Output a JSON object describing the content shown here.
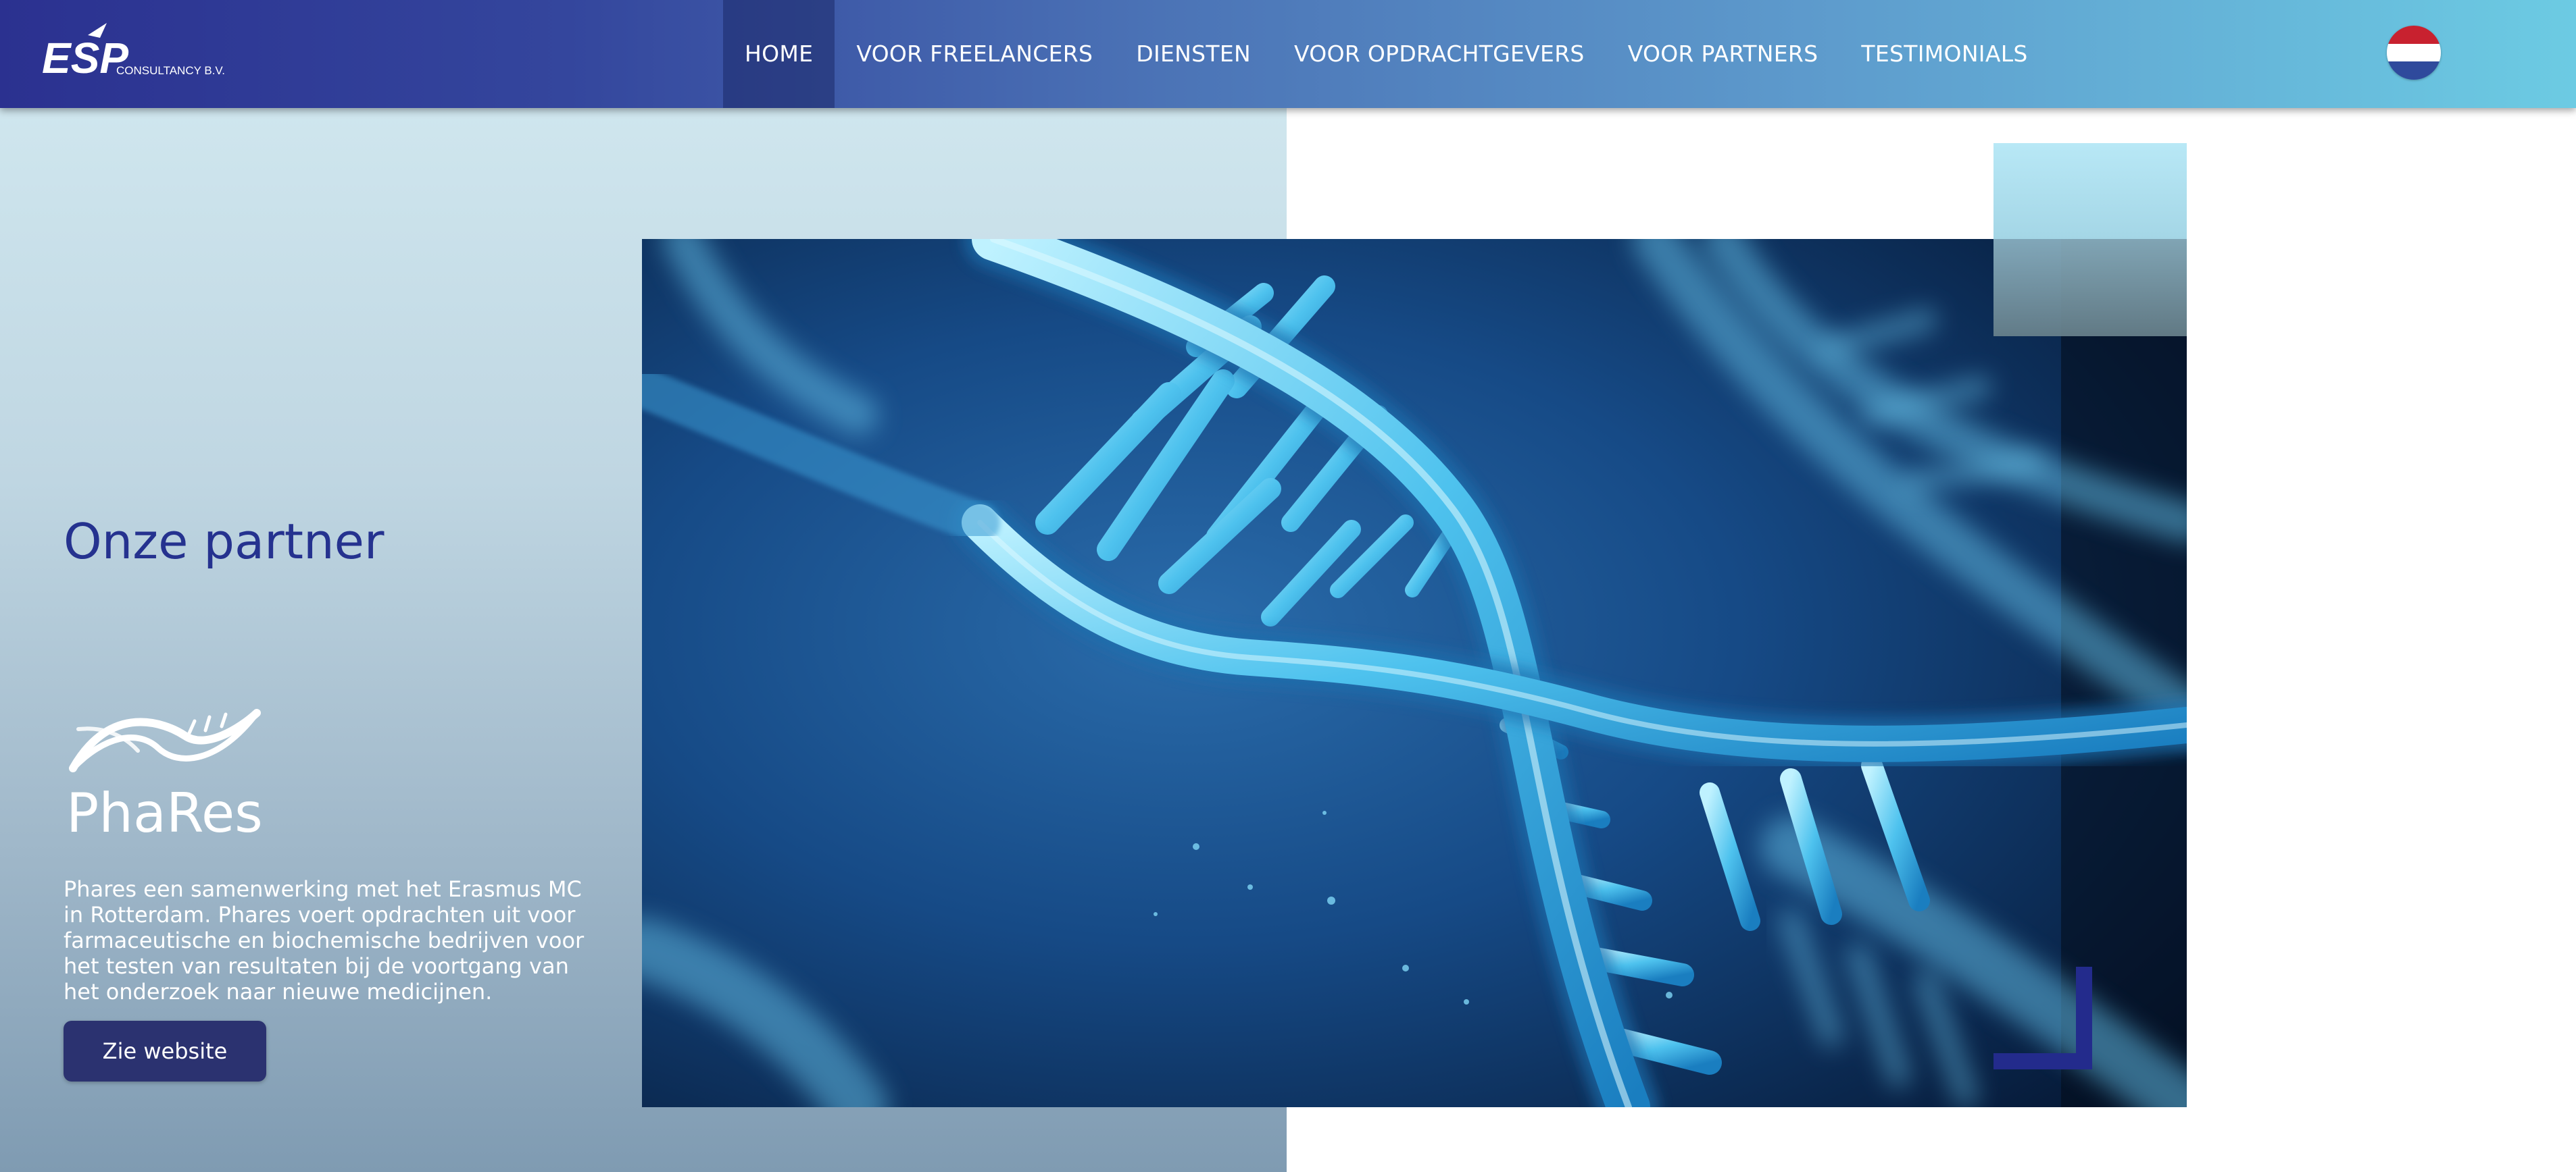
{
  "brand": {
    "logo_letters": "ESP",
    "logo_subtitle": "CONSULTANCY B.V."
  },
  "nav": {
    "items": [
      {
        "label": "HOME",
        "active": true
      },
      {
        "label": "VOOR FREELANCERS"
      },
      {
        "label": "DIENSTEN"
      },
      {
        "label": "VOOR OPDRACHTGEVERS"
      },
      {
        "label": "VOOR PARTNERS"
      },
      {
        "label": "TESTIMONIALS"
      }
    ]
  },
  "language": {
    "flag": "dutch-flag-icon",
    "colors": [
      "#c8212f",
      "#ffffff",
      "#2f4a9c"
    ]
  },
  "partner": {
    "section_title": "Onze partner",
    "logo_text": "PhaRes",
    "description": "Phares een samenwerking met het Erasmus MC in Rotterdam. Phares voert opdrachten uit voor farmaceutische en biochemische bedrijven voor het testen van resultaten bij de voortgang van het onderzoek naar nieuwe medicijnen.",
    "button_label": "Zie website"
  },
  "hero": {
    "image": "dna-helix-image"
  },
  "colors": {
    "title_blue": "#25328f",
    "button_dark": "#2b3270",
    "accent_navy": "#232b8c",
    "nav_gradient_start": "#2b3190",
    "nav_gradient_end": "#6ccbe3"
  }
}
